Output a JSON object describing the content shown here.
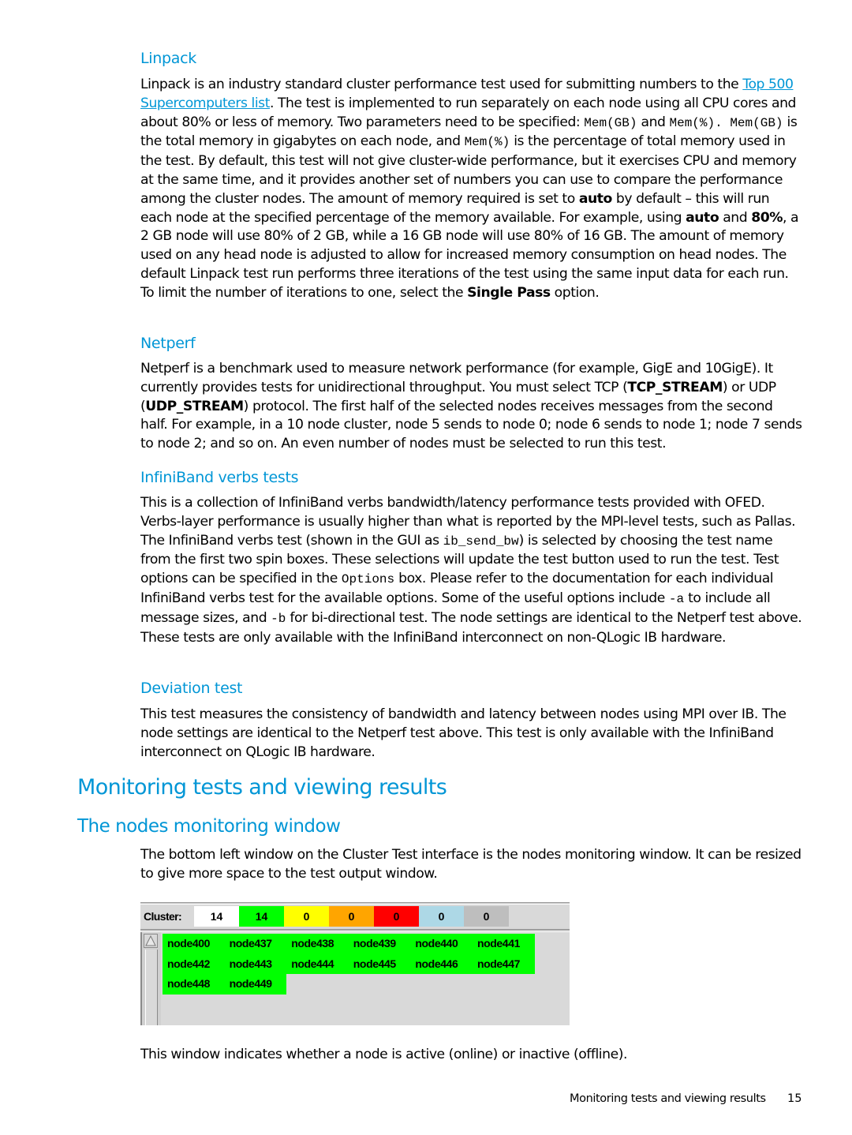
{
  "sections": {
    "linpack": {
      "heading": "Linpack",
      "p": [
        "Linpack is an industry standard cluster performance test used for submitting numbers to the ",
        "Top 500 Supercomputers list",
        ". The test is implemented to run separately on each node using all CPU cores and about 80% or less of memory. Two parameters need to be specified: ",
        "Mem(GB)",
        " and ",
        "Mem(%)",
        ". ",
        "Mem(GB)",
        " is the total memory in gigabytes on each node, and ",
        "Mem(%)",
        " is the percentage of total memory used in the test. By default, this test will not give cluster-wide performance, but it exercises CPU and memory at the same time, and it provides another set of numbers you can use to compare the performance among the cluster nodes. The amount of memory required is set to ",
        "auto",
        " by default – this will run each node at the specified percentage of the memory available. For example, using ",
        "auto",
        " and ",
        "80%",
        ", a 2 GB node will use 80% of 2 GB, while a 16 GB node will use 80% of 16 GB. The amount of memory used on any head node is adjusted to allow for increased memory consumption on head nodes. The default Linpack test run performs three iterations of the test using the same input data for each run. To limit the number of iterations to one, select the ",
        "Single Pass",
        " option."
      ]
    },
    "netperf": {
      "heading": "Netperf",
      "p": [
        "Netperf is a benchmark used to measure network performance (for example, GigE and 10GigE). It currently provides tests for unidirectional throughput. You must select TCP (",
        "TCP_STREAM",
        ") or UDP (",
        "UDP_STREAM",
        ") protocol. The first half of the selected nodes receives messages from the second half. For example, in a 10 node cluster, node 5 sends to node 0; node 6 sends to node 1; node 7 sends to node 2; and so on. An even number of nodes must be selected to run this test."
      ]
    },
    "infiniband": {
      "heading": "InfiniBand verbs tests",
      "p": [
        "This is a collection of InfiniBand verbs bandwidth/latency performance tests provided with OFED. Verbs-layer performance is usually higher than what is reported by the MPI-level tests, such as Pallas. The InfiniBand verbs test (shown in the GUI as ",
        "ib_send_bw",
        ") is selected by choosing the test name from the first two spin boxes. These selections will update the test button used to run the test. Test options can be specified in the ",
        "Options",
        " box. Please refer to the documentation for each individual InfiniBand verbs test for the available options. Some of the useful options include ",
        "-a",
        " to include all message sizes, and ",
        "-b",
        " for bi-directional test. The node settings are identical to the Netperf test above. These tests are only available with the InfiniBand interconnect on non-QLogic IB hardware."
      ]
    },
    "deviation": {
      "heading": "Deviation test",
      "p": "This test measures the consistency of bandwidth and latency between nodes using MPI over IB. The node settings are identical to the Netperf test above. This test is only available with the InfiniBand interconnect on QLogic IB hardware."
    },
    "monitoring": {
      "heading": "Monitoring tests and viewing results",
      "subheading": "The nodes monitoring window",
      "intro": "The bottom left window on the Cluster Test interface is the nodes monitoring window. It can be resized to give more space to the test output window.",
      "after": "This window indicates whether a node is active (online) or inactive (offline)."
    }
  },
  "monitor": {
    "cluster_label": "Cluster:",
    "counts": [
      {
        "value": "14",
        "color": "#ffffff"
      },
      {
        "value": "14",
        "color": "#00ff00"
      },
      {
        "value": "0",
        "color": "#ffff00"
      },
      {
        "value": "0",
        "color": "#ffa500"
      },
      {
        "value": "0",
        "color": "#ff0000"
      },
      {
        "value": "0",
        "color": "#add8e6"
      },
      {
        "value": "0",
        "color": "#bebebe"
      }
    ],
    "node_color": "#00ff00",
    "nodes": [
      "node400",
      "node437",
      "node438",
      "node439",
      "node440",
      "node441",
      "node442",
      "node443",
      "node444",
      "node445",
      "node446",
      "node447",
      "node448",
      "node449"
    ]
  },
  "footer": {
    "title": "Monitoring tests and viewing results",
    "page": "15"
  }
}
